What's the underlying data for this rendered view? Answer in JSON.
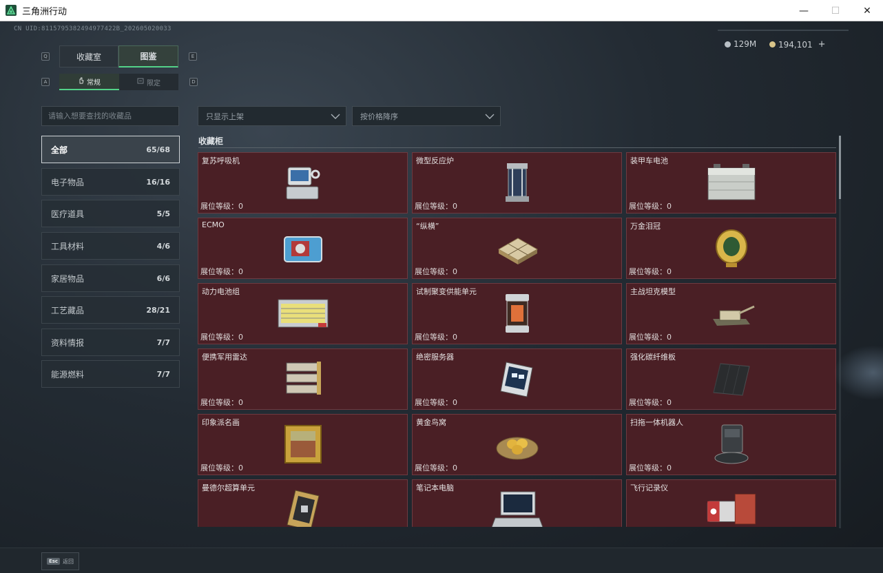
{
  "window": {
    "title": "三角洲行动",
    "minimize": "—",
    "maximize": "☐",
    "close": "✕"
  },
  "uid": "CN UID:8115795382494977422B_202605020033",
  "currency": [
    {
      "amount": "129M",
      "color": "#b9c0c6"
    },
    {
      "amount": "194,101",
      "color": "#d8c489",
      "plus": "+"
    }
  ],
  "keys": {
    "tab_prev": "Q",
    "tab_next": "E",
    "sub_prev": "A",
    "sub_next": "D"
  },
  "tabs": [
    {
      "label": "收藏室"
    },
    {
      "label": "图鉴"
    }
  ],
  "subtabs": [
    {
      "label": "常规"
    },
    {
      "label": "限定"
    }
  ],
  "search": {
    "placeholder": "请输入想要查找的收藏品"
  },
  "filters": {
    "listing": "只显示上架",
    "sort": "按价格降序"
  },
  "categories": [
    {
      "label": "全部",
      "count": "65/68"
    },
    {
      "label": "电子物品",
      "count": "16/16"
    },
    {
      "label": "医疗道具",
      "count": "5/5"
    },
    {
      "label": "工具材料",
      "count": "4/6"
    },
    {
      "label": "家居物品",
      "count": "6/6"
    },
    {
      "label": "工艺藏品",
      "count": "28/21"
    },
    {
      "label": "资料情报",
      "count": "7/7"
    },
    {
      "label": "能源燃料",
      "count": "7/7"
    }
  ],
  "section_title": "收藏柜",
  "items": [
    {
      "name": "复苏呼吸机",
      "level": "展位等级：0",
      "icon": "ventilator-icon"
    },
    {
      "name": "微型反应炉",
      "level": "展位等级：0",
      "icon": "reactor-icon"
    },
    {
      "name": "装甲车电池",
      "level": "展位等级：0",
      "icon": "battery-icon"
    },
    {
      "name": "ECMO",
      "level": "展位等级：0",
      "icon": "ecmo-icon"
    },
    {
      "name": "“纵横”",
      "level": "展位等级：0",
      "icon": "chessboard-icon"
    },
    {
      "name": "万金泪冠",
      "level": "展位等级：0",
      "icon": "golden-egg-icon"
    },
    {
      "name": "动力电池组",
      "level": "展位等级：0",
      "icon": "battery-pack-icon"
    },
    {
      "name": "试制聚变供能单元",
      "level": "展位等级：0",
      "icon": "fusion-unit-icon"
    },
    {
      "name": "主战坦克模型",
      "level": "展位等级：0",
      "icon": "tank-icon"
    },
    {
      "name": "便携军用雷达",
      "level": "展位等级：0",
      "icon": "radar-icon"
    },
    {
      "name": "绝密服务器",
      "level": "展位等级：0",
      "icon": "server-icon"
    },
    {
      "name": "强化碳纤维板",
      "level": "展位等级：0",
      "icon": "carbon-plate-icon"
    },
    {
      "name": "印象派名画",
      "level": "展位等级：0",
      "icon": "painting-icon"
    },
    {
      "name": "黄金鸟窝",
      "level": "展位等级：0",
      "icon": "bird-nest-icon"
    },
    {
      "name": "扫拖一体机器人",
      "level": "展位等级：0",
      "icon": "robot-vacuum-icon"
    },
    {
      "name": "曼德尔超算单元",
      "level": "",
      "icon": "cpu-icon"
    },
    {
      "name": "笔记本电脑",
      "level": "",
      "icon": "laptop-icon"
    },
    {
      "name": "飞行记录仪",
      "level": "",
      "icon": "flight-recorder-icon"
    }
  ],
  "footer": {
    "esc_key": "Esc",
    "esc_label": "返回"
  }
}
